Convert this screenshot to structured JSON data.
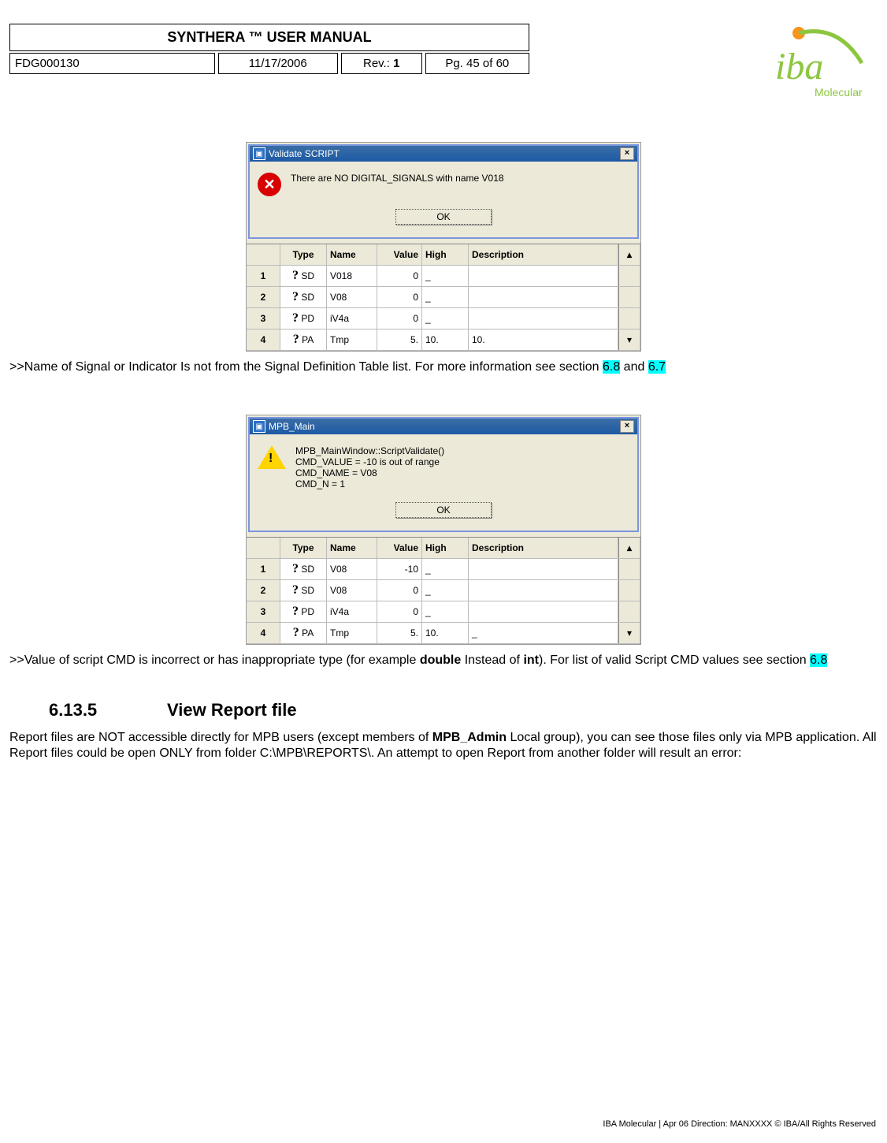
{
  "header": {
    "title": "SYNTHERA ™ USER MANUAL",
    "doc_id": "FDG000130",
    "date": "11/17/2006",
    "rev_label": "Rev.: ",
    "rev_num": "1",
    "page": "Pg. 45 of 60"
  },
  "logo": {
    "brand": "iba",
    "sub": "Molecular"
  },
  "dialog1": {
    "title": "Validate SCRIPT",
    "message": "There are NO DIGITAL_SIGNALS with name V018",
    "ok": "OK"
  },
  "grid1": {
    "headers": {
      "type": "Type",
      "name": "Name",
      "value": "Value",
      "high": "High",
      "desc": "Description"
    },
    "rows": [
      {
        "n": "1",
        "type": "SD",
        "name": "V018",
        "value": "0",
        "high": "_"
      },
      {
        "n": "2",
        "type": "SD",
        "name": "V08",
        "value": "0",
        "high": "_"
      },
      {
        "n": "3",
        "type": "PD",
        "name": "iV4a",
        "value": "0",
        "high": "_"
      },
      {
        "n": "4",
        "type": "PA",
        "name": "Tmp",
        "value": "5.",
        "high": "10."
      }
    ]
  },
  "text1": {
    "pre": ">>Name of Signal or Indicator Is not from the Signal Definition Table list. For more information see section ",
    "link1": "6.8",
    "mid": " and ",
    "link2": "6.7"
  },
  "dialog2": {
    "title": "MPB_Main",
    "message": "MPB_MainWindow::ScriptValidate()\nCMD_VALUE = -10 is out of range\nCMD_NAME = V08\nCMD_N = 1",
    "ok": "OK"
  },
  "grid2": {
    "headers": {
      "type": "Type",
      "name": "Name",
      "value": "Value",
      "high": "High",
      "desc": "Description"
    },
    "rows": [
      {
        "n": "1",
        "type": "SD",
        "name": "V08",
        "value": "-10",
        "high": "_"
      },
      {
        "n": "2",
        "type": "SD",
        "name": "V08",
        "value": "0",
        "high": "_"
      },
      {
        "n": "3",
        "type": "PD",
        "name": "iV4a",
        "value": "0",
        "high": "_"
      },
      {
        "n": "4",
        "type": "PA",
        "name": "Tmp",
        "value": "5.",
        "high": "10."
      }
    ]
  },
  "text2": {
    "pre": ">>Value of script CMD is incorrect or has inappropriate type (for example ",
    "b1": "double",
    "mid1": " Instead of ",
    "b2": "int",
    "mid2": "). For list of valid Script CMD values see section ",
    "link1": "6.8"
  },
  "section": {
    "num": "6.13.5",
    "title": "View Report file"
  },
  "para": {
    "t1": "Report files are NOT accessible directly for MPB users (except members of ",
    "b1": "MPB_Admin",
    "t2": " Local group), you can see those files only via MPB application. All Report files could be open ONLY from folder C:\\MPB\\REPORTS\\. An attempt to open Report from another folder will result an error:"
  },
  "footer": "IBA Molecular  |  Apr 06 Direction: MANXXXX © IBA/All Rights Reserved"
}
